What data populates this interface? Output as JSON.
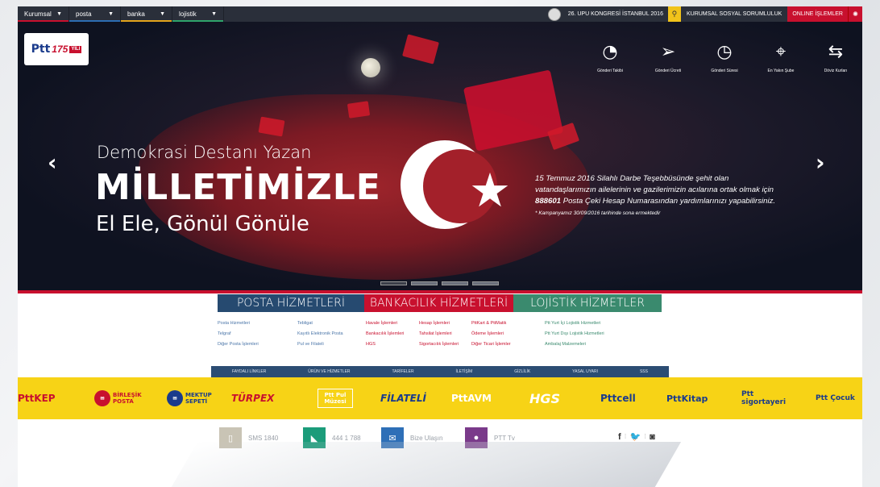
{
  "topbar": {
    "menus": [
      "Kurumsal",
      "posta",
      "banka",
      "lojistik"
    ],
    "upu": "26. UPU KONGRESİ İSTANBUL 2016",
    "kurumsal": "KURUMSAL SOSYAL SORUMLULUK",
    "online": "ONLINE İŞLEMLER"
  },
  "hero": {
    "logo": {
      "ptt": "Ptt",
      "num": "175",
      "yili": "YILI"
    },
    "line1": "Demokrasi Destanı Yazan",
    "line2": "MİLLETİMİZLE",
    "line3": "El Ele, Gönül Gönüle",
    "right_text_1": "15 Temmuz 2016 Silahlı Darbe Teşebbüsünde şehit olan vatandaşlarımızın ailelerinin ve gazilerimizin acılarına ortak olmak için",
    "right_code": "888601",
    "right_text_2": "Posta Çeki Hesap Numarasından yardımlarınızı yapabilirsiniz.",
    "right_note": "* Kampanyamız 30/09/2016 tarihinde sona ermektedir",
    "slides": 4,
    "active_slide": 1,
    "quick_links": [
      {
        "label": "Gönderi Takibi",
        "icon": "tracking-icon"
      },
      {
        "label": "Gönderi Ücreti",
        "icon": "paper-plane-icon"
      },
      {
        "label": "Gönderi Süresi",
        "icon": "timer-icon"
      },
      {
        "label": "En Yakın Şube",
        "icon": "location-pin-icon"
      },
      {
        "label": "Döviz Kurları",
        "icon": "exchange-arrows-icon"
      }
    ]
  },
  "services": {
    "tabs": [
      "POSTA HİZMETLERİ",
      "BANKACILIK HİZMETLERİ",
      "LOJİSTİK HİZMETLER"
    ],
    "posta_col1": [
      "Posta Hizmetleri",
      "Telgraf",
      "Diğer Posta İşlemleri"
    ],
    "posta_col2": [
      "Tebligat",
      "Kayıtlı Elektronik Posta",
      "Pul ve Filateli"
    ],
    "banka_col1": [
      "Havale İşlemleri",
      "Bankacılık İşlemleri",
      "HGS"
    ],
    "banka_col2": [
      "Hesap İşlemleri",
      "Tahsilat İşlemleri",
      "Sigortacılık İşlemleri"
    ],
    "banka_col3": [
      "PttKart & PttMatik",
      "Ödeme İşlemleri",
      "Diğer Ticari İşlemler"
    ],
    "lojistik_col": [
      "Ptt Yurt İçi Lojistik Hizmetleri",
      "Ptt Yurt Dışı Lojistik Hizmetleri",
      "Ambalaj Malzemeleri"
    ]
  },
  "footlinks": [
    "FAYDALI LİNKLER",
    "ÜRÜN VE HİZMETLER",
    "TARİFELER",
    "İLETİŞİM",
    "GİZLİLİK",
    "YASAL UYARI",
    "SSS"
  ],
  "brands": [
    {
      "name": "PttKEP",
      "color": "#c8102e"
    },
    {
      "name": "BİRLEŞİK POSTA",
      "color": "#c8102e"
    },
    {
      "name": "MEKTUP SEPETİ",
      "color": "#1a3b8c"
    },
    {
      "name": "TÜRPEX",
      "color": "#c8102e"
    },
    {
      "name": "Ptt Pul Müzesi",
      "color": "#ffffff"
    },
    {
      "name": "FİLATELİ",
      "color": "#1a3b8c"
    },
    {
      "name": "PttAVM",
      "color": "#ffffff"
    },
    {
      "name": "HGS",
      "color": "#ffffff"
    },
    {
      "name": "Pttcell",
      "color": "#1a3b8c"
    },
    {
      "name": "PttKitap",
      "color": "#1a3b8c"
    },
    {
      "name": "Ptt sigortayeri",
      "color": "#1a3b8c"
    },
    {
      "name": "Ptt Çocuk",
      "color": "#1a3b8c"
    }
  ],
  "contact": [
    {
      "label": "SMS 1840",
      "color": "#c9c4b5"
    },
    {
      "label": "444 1 788",
      "color": "#1b9c7a"
    },
    {
      "label": "Bize Ulaşın",
      "color": "#2e6fb7"
    },
    {
      "label": "PTT Tv",
      "color": "#7a3a8a"
    }
  ],
  "social": [
    "f",
    "y",
    "i"
  ]
}
